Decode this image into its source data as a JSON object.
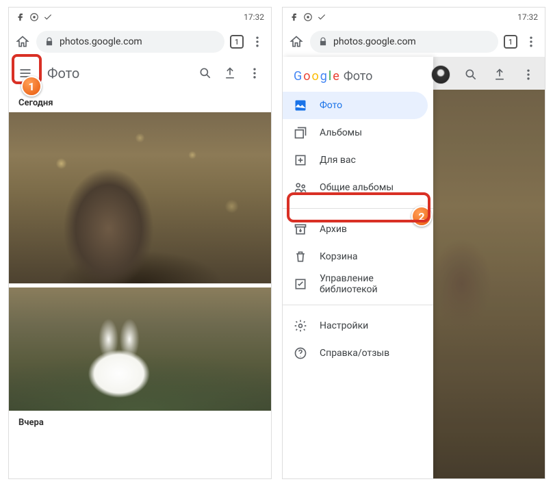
{
  "status": {
    "time": "17:32"
  },
  "browser": {
    "url": "photos.google.com",
    "tabs": "1"
  },
  "app": {
    "title": "Фото"
  },
  "sections": {
    "today": "Сегодня",
    "yesterday": "Вчера"
  },
  "google_logo": "Google",
  "drawer": {
    "suffix": "Фото",
    "items": [
      "Фото",
      "Альбомы",
      "Для вас",
      "Общие альбомы"
    ],
    "secondary": [
      "Архив",
      "Корзина",
      "Управление библиотекой"
    ],
    "tertiary": [
      "Настройки",
      "Справка/отзыв"
    ]
  },
  "badges": {
    "one": "1",
    "two": "2"
  }
}
